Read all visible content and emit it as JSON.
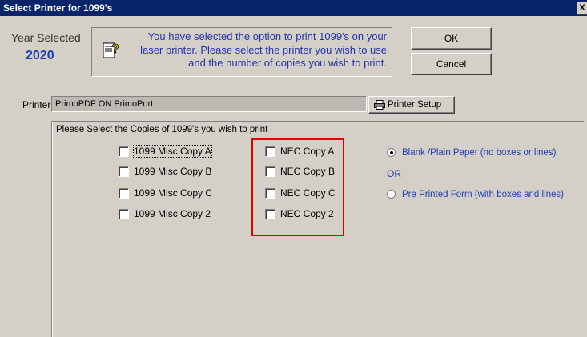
{
  "window": {
    "title": "Select Printer for 1099's",
    "close_label": "X"
  },
  "year": {
    "label": "Year Selected",
    "value": "2020"
  },
  "info": {
    "icon": "question-icon",
    "message": "You have selected the option to print 1099's on your laser printer.  Please select the printer you wish to use and the number of copies you wish to print."
  },
  "buttons": {
    "ok": "OK",
    "cancel": "Cancel",
    "printer_setup": "Printer Setup"
  },
  "printer": {
    "label": "Printer",
    "value": "PrimoPDF ON PrimoPort:"
  },
  "copies": {
    "group_title": "Please Select the Copies of 1099's you wish to print",
    "misc": [
      "1099 Misc Copy A",
      "1099 Misc Copy B",
      "1099 Misc Copy C",
      "1099 Misc Copy 2"
    ],
    "nec": [
      "NEC Copy A",
      "NEC Copy B",
      "NEC Copy C",
      "NEC Copy 2"
    ]
  },
  "paper": {
    "option_blank": "Blank /Plain Paper (no boxes or lines)",
    "or_text": "OR",
    "option_preprinted": "Pre Printed  Form (with boxes and lines)",
    "selected": "blank"
  },
  "colors": {
    "title_bar": "#0a246a",
    "accent_blue": "#1f3fb4",
    "highlight_red": "#e00000",
    "dialog_bg": "#d4d0c8"
  }
}
